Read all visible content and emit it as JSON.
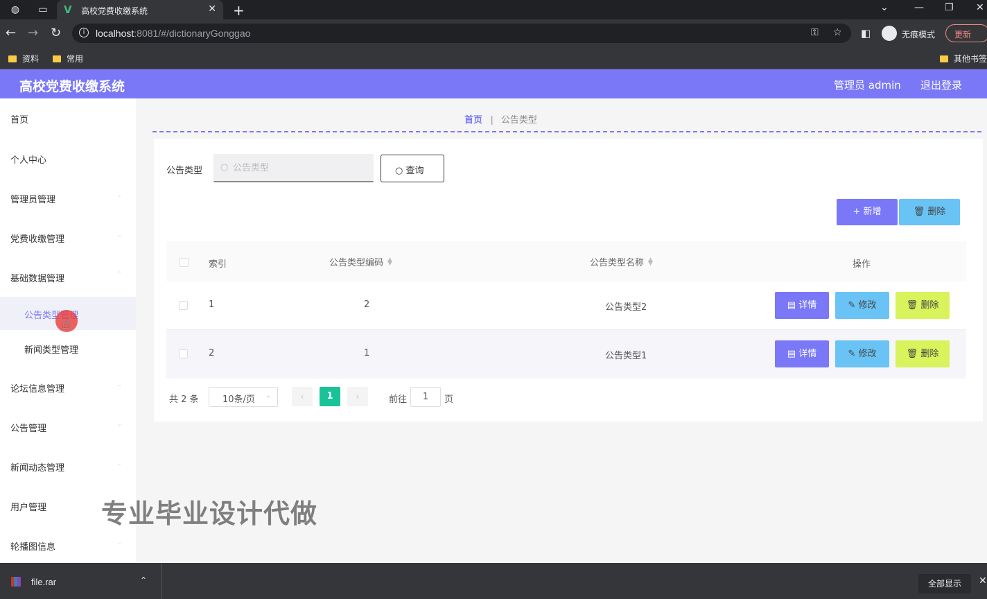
{
  "browser": {
    "tab_title": "高校党费收缴系统",
    "url_host": "localhost",
    "url_rest": ":8081/#/dictionaryGonggao",
    "incognito_label": "无痕模式",
    "update_label": "更新",
    "bookmarks": [
      "资料",
      "常用"
    ],
    "other_bookmarks": "其他书签"
  },
  "header": {
    "title": "高校党费收缴系统",
    "user": "管理员 admin",
    "logout": "退出登录",
    "color": "#7a78f7"
  },
  "sidebar": {
    "items": [
      {
        "label": "首页"
      },
      {
        "label": "个人中心"
      },
      {
        "label": "管理员管理"
      },
      {
        "label": "党费收缴管理"
      },
      {
        "label": "基础数据管理"
      },
      {
        "label": "公告类型管理"
      },
      {
        "label": "新闻类型管理"
      },
      {
        "label": "论坛信息管理"
      },
      {
        "label": "公告管理"
      },
      {
        "label": "新闻动态管理"
      },
      {
        "label": "用户管理"
      },
      {
        "label": "轮播图信息"
      }
    ]
  },
  "breadcrumb": {
    "home": "首页",
    "current": "公告类型"
  },
  "search": {
    "label": "公告类型",
    "placeholder": "公告类型",
    "button": "查询"
  },
  "actions": {
    "add": "新增",
    "delete": "删除"
  },
  "table": {
    "columns": [
      "索引",
      "公告类型编码",
      "公告类型名称",
      "操作"
    ],
    "rows": [
      {
        "index": "1",
        "code": "2",
        "name": "公告类型2"
      },
      {
        "index": "2",
        "code": "1",
        "name": "公告类型1"
      }
    ],
    "row_actions": {
      "detail": "详情",
      "edit": "修改",
      "delete": "删除"
    }
  },
  "pagination": {
    "total": "共 2 条",
    "page_size": "10条/页",
    "current": "1",
    "goto_label": "前往",
    "goto_value": "1",
    "page_unit": "页"
  },
  "watermark": "专业毕业设计代做",
  "downloads": {
    "file": "file.rar",
    "show_all": "全部显示"
  }
}
